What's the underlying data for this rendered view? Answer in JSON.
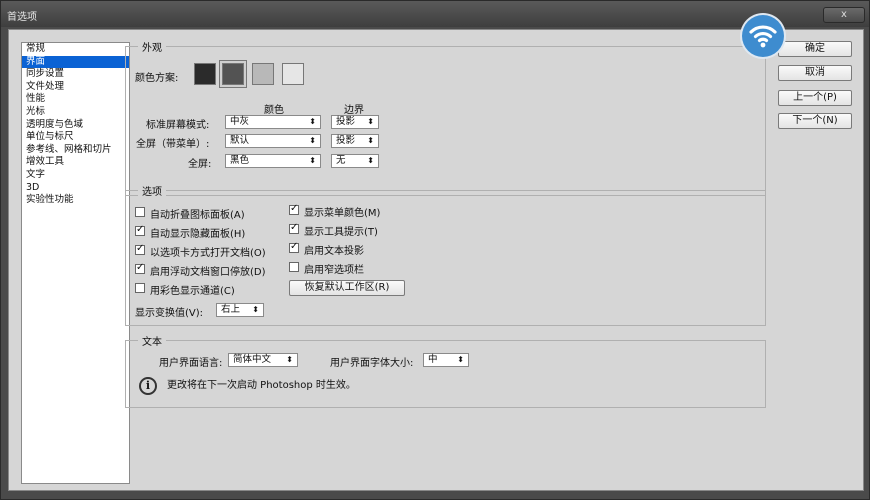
{
  "window": {
    "title": "首选项",
    "close_label": "x"
  },
  "sidebar": {
    "items": [
      {
        "label": "常规"
      },
      {
        "label": "界面",
        "selected": true
      },
      {
        "label": "同步设置"
      },
      {
        "label": "文件处理"
      },
      {
        "label": "性能"
      },
      {
        "label": "光标"
      },
      {
        "label": "透明度与色域"
      },
      {
        "label": "单位与标尺"
      },
      {
        "label": "参考线、网格和切片"
      },
      {
        "label": "增效工具"
      },
      {
        "label": "文字"
      },
      {
        "label": "3D"
      },
      {
        "label": "实验性功能"
      }
    ]
  },
  "appearance": {
    "legend": "外观",
    "color_scheme_label": "颜色方案:",
    "swatches": [
      "#2b2b2b",
      "#535353",
      "#b8b8b8",
      "#e6e6e6"
    ],
    "selected_swatch": 1,
    "col_color": "颜色",
    "col_border": "边界",
    "rows": [
      {
        "label": "标准屏幕模式:",
        "color": "中灰",
        "border": "投影"
      },
      {
        "label": "全屏（带菜单）:",
        "color": "默认",
        "border": "投影"
      },
      {
        "label": "全屏:",
        "color": "黑色",
        "border": "无"
      }
    ]
  },
  "options": {
    "legend": "选项",
    "left": [
      {
        "label": "自动折叠图标面板(A)",
        "checked": false
      },
      {
        "label": "自动显示隐藏面板(H)",
        "checked": true
      },
      {
        "label": "以选项卡方式打开文档(O)",
        "checked": true
      },
      {
        "label": "启用浮动文档窗口停放(D)",
        "checked": true
      },
      {
        "label": "用彩色显示通道(C)",
        "checked": false
      }
    ],
    "right": [
      {
        "label": "显示菜单颜色(M)",
        "checked": true
      },
      {
        "label": "显示工具提示(T)",
        "checked": true
      },
      {
        "label": "启用文本投影",
        "checked": true
      },
      {
        "label": "启用窄选项栏",
        "checked": false
      }
    ],
    "restore_button": "恢复默认工作区(R)",
    "transform_label": "显示变换值(V):",
    "transform_value": "右上"
  },
  "text_section": {
    "legend": "文本",
    "lang_label": "用户界面语言:",
    "lang_value": "简体中文",
    "size_label": "用户界面字体大小:",
    "size_value": "中",
    "info": "更改将在下一次启动 Photoshop 时生效。"
  },
  "buttons": {
    "ok": "确定",
    "cancel": "取消",
    "prev": "上一个(P)",
    "next": "下一个(N)"
  },
  "icons": {
    "dropdown": "dropdown-arrow",
    "checkmark": "check-icon",
    "info": "info-icon"
  }
}
